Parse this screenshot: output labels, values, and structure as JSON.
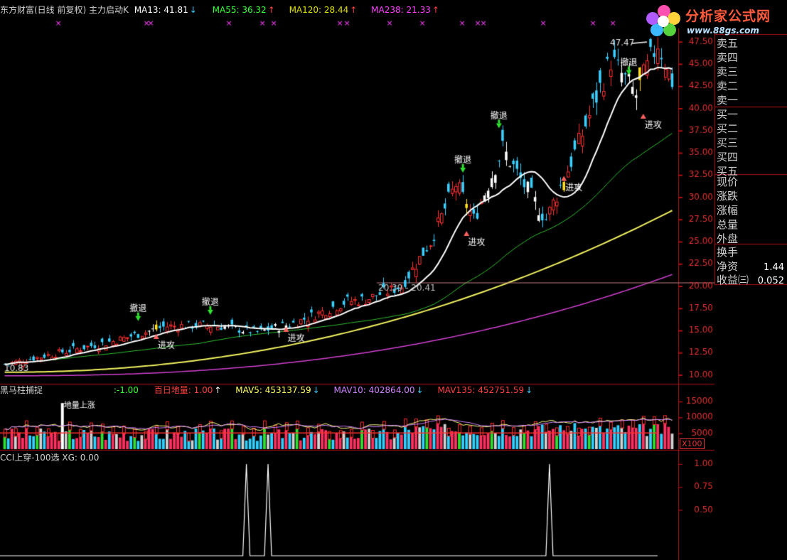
{
  "header_main": {
    "title": "东方财富(日线 前复权) 主力启动K",
    "ma13": "MA13: 41.81",
    "ma13_arrow": "↓",
    "ma55": "MA55: 36.32",
    "ma55_arrow": "↑",
    "ma120": "MA120: 28.44",
    "ma120_arrow": "↑",
    "ma238": "MA238: 21.33",
    "ma238_arrow": "↑"
  },
  "header_vol": {
    "title": "黑马柱捕捉",
    "neg": ":-1.00",
    "baidi": "百日地量: 1.00",
    "baidi_arrow": "↑",
    "mav5": "MAV5: 453137.59",
    "mav5_arrow": "↓",
    "mav10": "MAV10: 402864.00",
    "mav10_arrow": "↓",
    "mav135": "MAV135: 452751.59",
    "mav135_arrow": "↓"
  },
  "header_cci": {
    "title": "CCI上穿-100选 XG: 0.00"
  },
  "logo": {
    "name": "分析家公式网",
    "url": "www.88gs.com"
  },
  "right_panel": {
    "rows": [
      {
        "label": "卖五",
        "value": ""
      },
      {
        "label": "卖四",
        "value": ""
      },
      {
        "label": "卖三",
        "value": ""
      },
      {
        "label": "卖二",
        "value": ""
      },
      {
        "label": "卖一",
        "value": ""
      },
      {
        "label": "买一",
        "value": ""
      },
      {
        "label": "买二",
        "value": ""
      },
      {
        "label": "买三",
        "value": ""
      },
      {
        "label": "买四",
        "value": ""
      },
      {
        "label": "买五",
        "value": ""
      },
      {
        "label": "现价",
        "value": ""
      },
      {
        "label": "涨跌",
        "value": ""
      },
      {
        "label": "涨幅",
        "value": ""
      },
      {
        "label": "总量",
        "value": ""
      },
      {
        "label": "外盘",
        "value": ""
      },
      {
        "label": "换手",
        "value": ""
      },
      {
        "label": "净资",
        "value": "1.44"
      },
      {
        "label": "收益㈢",
        "value": "0.052"
      }
    ]
  },
  "x100_label": "X100",
  "chart_data": [
    {
      "type": "candlestick",
      "title": "东方财富(日线 前复权) 主力启动K",
      "y_ticks": [
        10.0,
        12.5,
        15.0,
        17.5,
        20.0,
        22.5,
        25.0,
        27.5,
        30.0,
        32.5,
        35.0,
        37.5,
        40.0,
        42.5,
        45.0,
        47.5
      ],
      "ylim": [
        9.0,
        49.0
      ],
      "range_label": "20.39 - 20.41",
      "max_label": "47.47",
      "min_label": "10.83",
      "annotations": [
        {
          "text": "撤退",
          "index": 37,
          "price": 16.3,
          "kind": "exit"
        },
        {
          "text": "进攻",
          "index": 42,
          "price": 14.2,
          "kind": "enter"
        },
        {
          "text": "撤退",
          "index": 57,
          "price": 17.0,
          "kind": "exit"
        },
        {
          "text": "进攻",
          "index": 78,
          "price": 15.0,
          "kind": "enter"
        },
        {
          "text": "撤退",
          "index": 127,
          "price": 33.0,
          "kind": "exit"
        },
        {
          "text": "进攻",
          "index": 128,
          "price": 25.8,
          "kind": "enter"
        },
        {
          "text": "撤退",
          "index": 137,
          "price": 38.0,
          "kind": "exit"
        },
        {
          "text": "进攻",
          "index": 155,
          "price": 32.0,
          "kind": "enter"
        },
        {
          "text": "撤退",
          "index": 173,
          "price": 44.0,
          "kind": "exit"
        },
        {
          "text": "进攻",
          "index": 177,
          "price": 39.0,
          "kind": "enter"
        }
      ]
    },
    {
      "type": "bar",
      "title": "黑马柱捕捉",
      "y_ticks": [
        5000,
        10000,
        15000
      ],
      "ylim": [
        0,
        17000
      ],
      "annotation": "地量上涨"
    },
    {
      "type": "line",
      "title": "CCI上穿-100选 XG: 0.00",
      "y_ticks": [
        0.5,
        0.75,
        1.0
      ],
      "ylim": [
        0,
        1.1
      ],
      "spikes_at_index": [
        67,
        73,
        151
      ]
    }
  ]
}
